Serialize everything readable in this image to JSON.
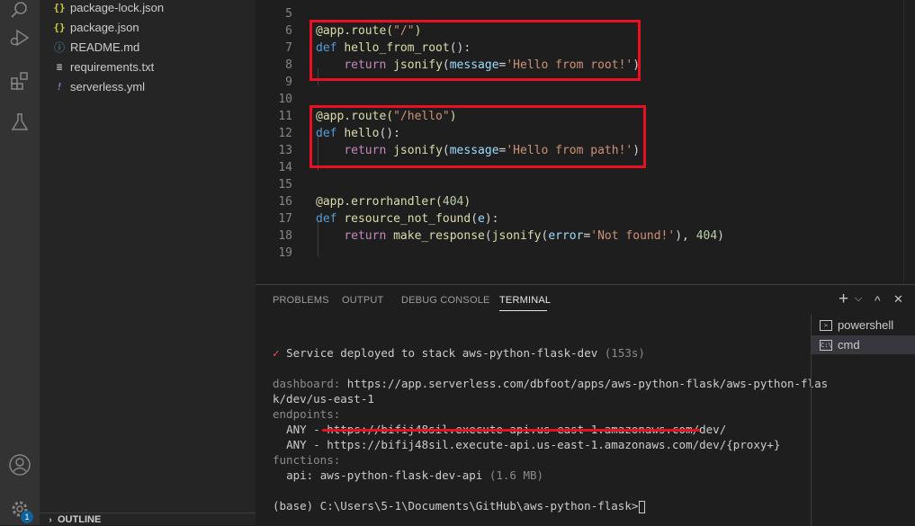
{
  "sidebar": {
    "files": [
      {
        "name": "package-lock.json",
        "icon": "json-icon",
        "glyph": "{}",
        "color": "#cbcb41"
      },
      {
        "name": "package.json",
        "icon": "json-icon",
        "glyph": "{}",
        "color": "#cbcb41"
      },
      {
        "name": "README.md",
        "icon": "info-icon",
        "glyph": "ⓘ",
        "color": "#519aba"
      },
      {
        "name": "requirements.txt",
        "icon": "text-file-icon",
        "glyph": "≡",
        "color": "#c5c5c5"
      },
      {
        "name": "serverless.yml",
        "icon": "yaml-icon",
        "glyph": "!",
        "color": "#a074c4"
      }
    ],
    "outline_label": "OUTLINE",
    "settings_badge": "1"
  },
  "editor": {
    "line_numbers": [
      "5",
      "6",
      "7",
      "8",
      "9",
      "10",
      "11",
      "12",
      "13",
      "14",
      "15",
      "16",
      "17",
      "18",
      "19"
    ],
    "code": {
      "l6_dec": "@app.route(",
      "l6_str": "\"/\"",
      "l6_end": ")",
      "l7_kw": "def",
      "l7_fn": "hello_from_root",
      "l7_end": "():",
      "l8_kw": "return",
      "l8_fn": "jsonify",
      "l8_open": "(",
      "l8_pm": "message",
      "l8_eq": "=",
      "l8_str": "'Hello from root!'",
      "l8_close": ")",
      "l11_dec": "@app.route(",
      "l11_str": "\"/hello\"",
      "l11_end": ")",
      "l12_kw": "def",
      "l12_fn": "hello",
      "l12_end": "():",
      "l13_kw": "return",
      "l13_fn": "jsonify",
      "l13_open": "(",
      "l13_pm": "message",
      "l13_eq": "=",
      "l13_str": "'Hello from path!'",
      "l13_close": ")",
      "l16_dec": "@app.errorhandler(",
      "l16_num": "404",
      "l16_end": ")",
      "l17_kw": "def",
      "l17_fn": "resource_not_found",
      "l17_open": "(",
      "l17_pm": "e",
      "l17_end": "):",
      "l18_kw": "return",
      "l18_fn1": "make_response",
      "l18_open1": "(",
      "l18_fn2": "jsonify",
      "l18_open2": "(",
      "l18_pm": "error",
      "l18_eq": "=",
      "l18_str": "'Not found!'",
      "l18_mid": "), ",
      "l18_num": "404",
      "l18_close": ")"
    }
  },
  "panel": {
    "tabs": [
      "PROBLEMS",
      "OUTPUT",
      "DEBUG CONSOLE",
      "TERMINAL"
    ],
    "active_tab": "TERMINAL",
    "add_button": "+",
    "dropdown": "⌵",
    "maximize": "^",
    "close": "✕",
    "terminals": [
      {
        "name": "powershell",
        "icon": "powershell-icon",
        "glyph": ">"
      },
      {
        "name": "cmd",
        "icon": "cmd-icon",
        "glyph": "C:\\"
      }
    ]
  },
  "terminal": {
    "check": "✓",
    "deployed": "Service deployed to stack aws-python-flask-dev",
    "deployed_time": "(153s)",
    "dashboard_label": "dashboard:",
    "dashboard_url_1": "https://app.serverless.com/dbfoot/apps/aws-python-flask/aws-python-flas",
    "dashboard_url_2": "k/dev/us-east-1",
    "endpoints_label": "endpoints:",
    "ep1_method": "ANY - ",
    "ep1_url": "https://bifij48sil.execute-api.us-east-1.amazonaws.com/dev/",
    "ep2_method": "ANY - ",
    "ep2_url": "https://bifij48sil.execute-api.us-east-1.amazonaws.com/dev/{proxy+}",
    "functions_label": "functions:",
    "fn_name": "api: aws-python-flask-dev-api",
    "fn_size": "(1.6 MB)",
    "prompt": "(base) C:\\Users\\5-1\\Documents\\GitHub\\aws-python-flask>"
  },
  "colors": {
    "highlight": "#e81123",
    "check": "#e8505b"
  }
}
